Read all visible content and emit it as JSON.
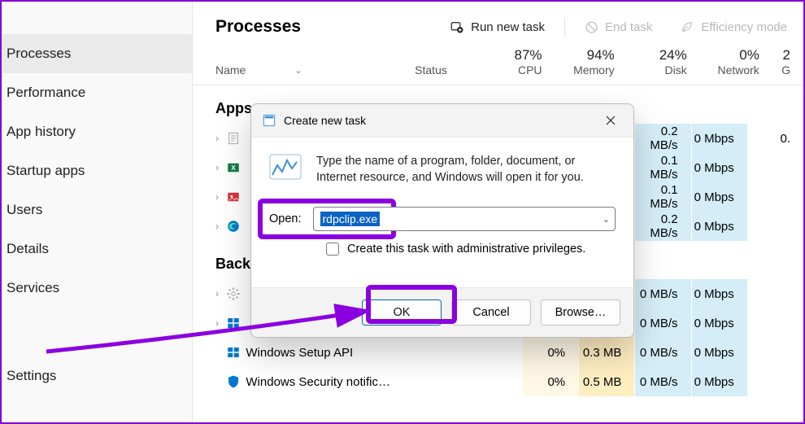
{
  "sidebar": {
    "items": [
      {
        "label": "Processes",
        "active": true
      },
      {
        "label": "Performance"
      },
      {
        "label": "App history"
      },
      {
        "label": "Startup apps"
      },
      {
        "label": "Users"
      },
      {
        "label": "Details"
      },
      {
        "label": "Services"
      },
      {
        "label": "Settings"
      }
    ]
  },
  "header": {
    "title": "Processes",
    "run_new_task": "Run new task",
    "end_task": "End task",
    "efficiency_mode": "Efficiency mode"
  },
  "columns": {
    "name": "Name",
    "status": "Status",
    "cpu": {
      "pct": "87%",
      "label": "CPU"
    },
    "memory": {
      "pct": "94%",
      "label": "Memory"
    },
    "disk": {
      "pct": "24%",
      "label": "Disk"
    },
    "network": {
      "pct": "0%",
      "label": "Network"
    },
    "gpu": {
      "pct": "2",
      "label": "G"
    }
  },
  "groups": {
    "apps": "Apps",
    "background": "Back"
  },
  "rows": {
    "app": [
      {
        "cpu": "",
        "mem": "",
        "dsk": "0.2 MB/s",
        "net": "0 Mbps",
        "ext": "0."
      },
      {
        "cpu": "",
        "mem": "",
        "dsk": "0.1 MB/s",
        "net": "0 Mbps",
        "ext": ""
      },
      {
        "cpu": "",
        "mem": "",
        "dsk": "0.1 MB/s",
        "net": "0 Mbps",
        "ext": ""
      },
      {
        "cpu": "",
        "mem": "",
        "dsk": "0.2 MB/s",
        "net": "0 Mbps",
        "ext": ""
      }
    ],
    "bg": [
      {
        "name": "",
        "cpu": "",
        "mem": "",
        "dsk": "0 MB/s",
        "net": "0 Mbps",
        "ext": ""
      },
      {
        "name": "",
        "cpu": "",
        "mem": "",
        "dsk": "0 MB/s",
        "net": "0 Mbps",
        "ext": ""
      },
      {
        "name": "Windows Setup API",
        "cpu": "0%",
        "mem": "0.3 MB",
        "dsk": "0 MB/s",
        "net": "0 Mbps",
        "ext": ""
      },
      {
        "name": "Windows Security notific…",
        "cpu": "0%",
        "mem": "0.5 MB",
        "dsk": "0 MB/s",
        "net": "0 Mbps",
        "ext": ""
      }
    ]
  },
  "dialog": {
    "title": "Create new task",
    "help": "Type the name of a program, folder, document, or Internet resource, and Windows will open it for you.",
    "open_label": "Open:",
    "value": "rdpclip.exe",
    "admin_label": "Create this task with administrative privileges.",
    "ok": "OK",
    "cancel": "Cancel",
    "browse": "Browse…"
  }
}
